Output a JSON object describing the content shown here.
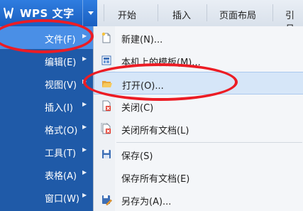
{
  "app": {
    "title": "WPS 文字"
  },
  "ribbon_tabs": [
    {
      "label": "开始"
    },
    {
      "label": "插入"
    },
    {
      "label": "页面布局"
    },
    {
      "label": "引月"
    }
  ],
  "left_menu": [
    {
      "label": "文件(F)",
      "active": true
    },
    {
      "label": "编辑(E)"
    },
    {
      "label": "视图(V)"
    },
    {
      "label": "插入(I)"
    },
    {
      "label": "格式(O)"
    },
    {
      "label": "工具(T)"
    },
    {
      "label": "表格(A)"
    },
    {
      "label": "窗口(W)"
    }
  ],
  "file_submenu": [
    {
      "label": "新建(N)...",
      "icon": "new-document-icon"
    },
    {
      "label": "本机上的模板(M)...",
      "icon": "template-icon"
    },
    {
      "label": "打开(O)...",
      "icon": "open-folder-icon",
      "highlighted": true
    },
    {
      "label": "关闭(C)",
      "icon": "close-document-icon"
    },
    {
      "label": "关闭所有文档(L)",
      "icon": "close-all-documents-icon"
    },
    {
      "label": "保存(S)",
      "icon": "save-icon"
    },
    {
      "label": "保存所有文档(E)",
      "icon": ""
    },
    {
      "label": "另存为(A)...",
      "icon": "save-as-icon"
    }
  ],
  "colors": {
    "menu_bg": "#1f5aa8",
    "menu_active": "#4a8fe6",
    "annotation": "#ec1c24",
    "highlight": "#d6e6f8"
  }
}
